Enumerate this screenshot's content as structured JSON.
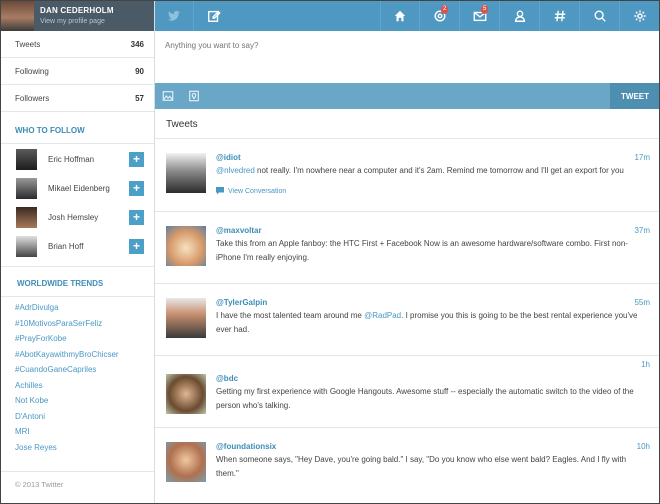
{
  "profile": {
    "name": "DAN CEDERHOLM",
    "link": "View my profile page"
  },
  "stats": [
    {
      "label": "Tweets",
      "value": "346"
    },
    {
      "label": "Following",
      "value": "90"
    },
    {
      "label": "Followers",
      "value": "57"
    }
  ],
  "who_to_follow": {
    "title": "WHO TO FOLLOW",
    "people": [
      {
        "name": "Eric Hoffman",
        "button": "+"
      },
      {
        "name": "Mikael Eidenberg",
        "button": "+"
      },
      {
        "name": "Josh Hemsley",
        "button": "+"
      },
      {
        "name": "Brian Hoff",
        "button": "+"
      }
    ]
  },
  "trends": {
    "title": "WORLDWIDE TRENDS",
    "items": [
      "#AdrDivulga",
      "#10MotivosParaSerFeliz",
      "#PrayForKobe",
      "#AbotKayawithmyBroChicser",
      "#CuandoGaneCapriles",
      "Achilles",
      "Not Kobe",
      "D'Antoni",
      "MRI",
      "Jose Reyes"
    ]
  },
  "footer": {
    "copyright": "© 2013 Twitter"
  },
  "nav": {
    "mentions_badge": "2",
    "messages_badge": "5",
    "icons": [
      "twitter-bird-icon",
      "compose-icon",
      "home-icon",
      "mentions-icon",
      "messages-icon",
      "profile-icon",
      "hashtag-icon",
      "search-icon",
      "settings-icon"
    ]
  },
  "compose": {
    "placeholder": "Anything you want to say?",
    "tweet_button": "TWEET"
  },
  "feed": {
    "title": "Tweets",
    "tweets": [
      {
        "user": "@idiot",
        "time": "17m",
        "mention": "@nlvedred",
        "text": " not really. I'm nowhere near a computer and it's 2am. Remind me tomorrow and I'll get an export for you",
        "conversation": "View Conversation"
      },
      {
        "user": "@maxvoltar",
        "time": "37m",
        "text": "Take this from an Apple fanboy: the HTC First + Facebook Now is an awesome hardware/software combo. First non-iPhone I'm really enjoying."
      },
      {
        "user": "@TylerGalpin",
        "time": "55m",
        "text_before": "I have the most talented team around me ",
        "mention": "@RadPad",
        "text_after": ". I promise you this is going to be the best rental experience you've ever had."
      },
      {
        "user": "@bdc",
        "time": "1h",
        "text": "Getting my first experience with Google Hangouts. Awesome stuff -- especially the automatic switch to the video of the person who's talking."
      },
      {
        "user": "@foundationsix",
        "time": "10h",
        "text": "When someone says, \"Hey Dave, you're going bald.\" I say, \"Do you know who else went bald? Eagles. And I fly with them.\""
      }
    ]
  },
  "colors": {
    "nav": "#4f98c2",
    "compose_bar": "#6aa7c6",
    "profile_bg": "#4a5a66",
    "link": "#4a97c4",
    "badge": "#d9534f"
  }
}
